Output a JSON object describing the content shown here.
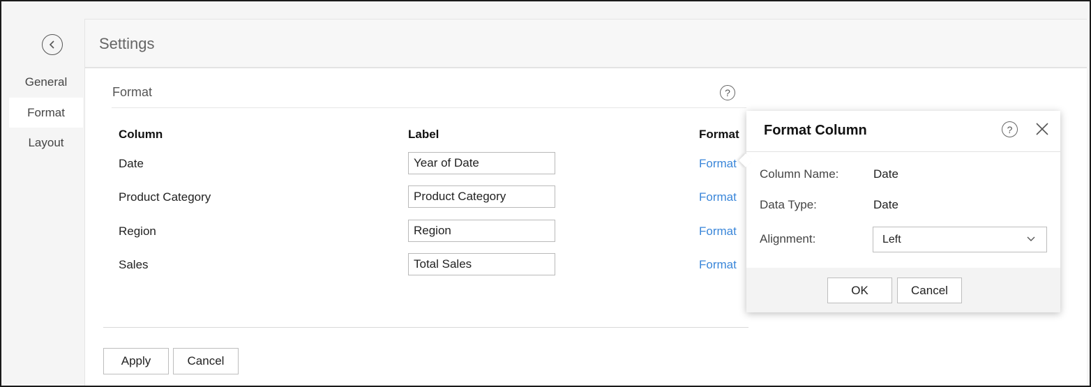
{
  "nav": {
    "items": [
      {
        "label": "General"
      },
      {
        "label": "Format"
      },
      {
        "label": "Layout"
      }
    ]
  },
  "header": {
    "title": "Settings"
  },
  "section": {
    "title": "Format"
  },
  "table": {
    "headers": {
      "column": "Column",
      "label": "Label",
      "format": "Format"
    },
    "rows": [
      {
        "column": "Date",
        "label": "Year of Date",
        "format": "Format"
      },
      {
        "column": "Product Category",
        "label": "Product Category",
        "format": "Format"
      },
      {
        "column": "Region",
        "label": "Region",
        "format": "Format"
      },
      {
        "column": "Sales",
        "label": "Total Sales",
        "format": "Format"
      }
    ]
  },
  "footer": {
    "apply_label": "Apply",
    "cancel_label": "Cancel"
  },
  "popup": {
    "title": "Format Column",
    "column_name_label": "Column Name:",
    "column_name_value": "Date",
    "data_type_label": "Data Type:",
    "data_type_value": "Date",
    "alignment_label": "Alignment:",
    "alignment_value": "Left",
    "ok_label": "OK",
    "cancel_label": "Cancel"
  },
  "icons": {
    "help": "?",
    "back": "chevron-left",
    "close": "x"
  },
  "colors": {
    "link": "#3a86d9",
    "active_nav_bg": "#ffffff",
    "page_bg": "#f5f5f5"
  }
}
